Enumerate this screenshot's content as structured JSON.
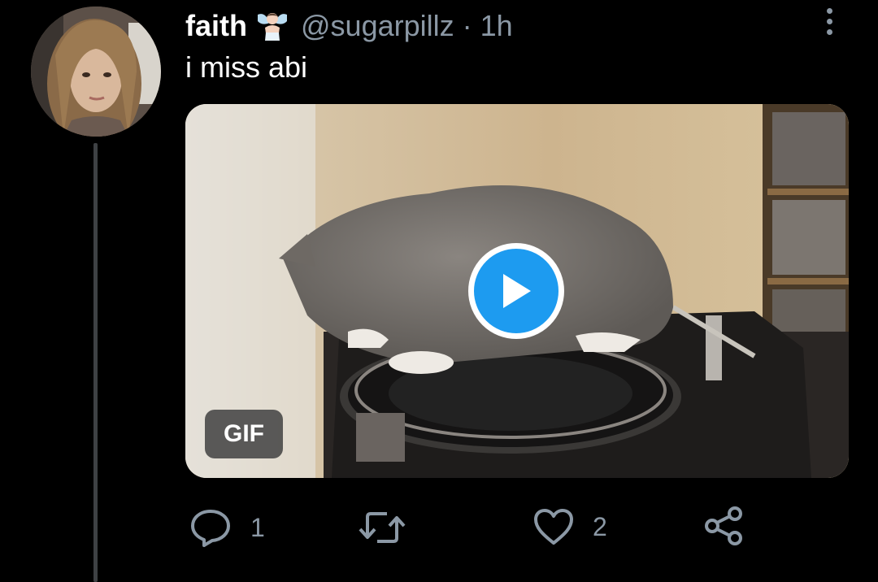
{
  "tweet": {
    "display_name": "faith",
    "name_emoji": "fairy-emoji",
    "handle": "@sugarpillz",
    "separator": "·",
    "time": "1h",
    "text": "i miss abi",
    "media": {
      "type": "gif",
      "badge": "GIF",
      "play_icon": "play-icon"
    },
    "actions": {
      "reply_count": "1",
      "retweet_count": "",
      "like_count": "2",
      "reply_icon": "reply-icon",
      "retweet_icon": "retweet-icon",
      "like_icon": "heart-icon",
      "share_icon": "share-icon"
    }
  },
  "colors": {
    "background": "#000000",
    "text_primary": "#ffffff",
    "text_secondary": "#8b98a5",
    "accent": "#1d9bf0",
    "thread_line": "#3e4144"
  }
}
